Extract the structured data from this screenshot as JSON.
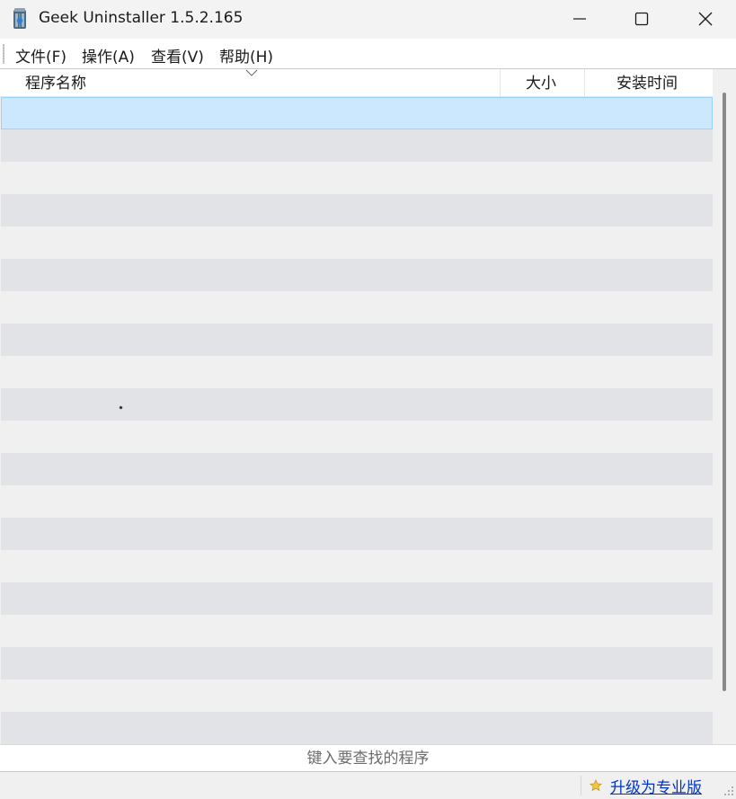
{
  "window": {
    "title": "Geek Uninstaller 1.5.2.165",
    "minimize_icon": "minimize-icon",
    "maximize_icon": "maximize-icon",
    "close_icon": "close-icon"
  },
  "menu": {
    "items": [
      {
        "label": "文件(F)"
      },
      {
        "label": "操作(A)"
      },
      {
        "label": "查看(V)"
      },
      {
        "label": "帮助(H)"
      }
    ]
  },
  "table": {
    "columns": [
      {
        "label": "程序名称"
      },
      {
        "label": "大小"
      },
      {
        "label": "安装时间"
      }
    ],
    "sort_icon": "chevron-down-icon",
    "rows": []
  },
  "search": {
    "placeholder": "键入要查找的程序",
    "value": ""
  },
  "status": {
    "upgrade_label": "升级为专业版",
    "star_icon": "star-icon",
    "link_color": "#0033cc",
    "selection_color": "#cce8ff"
  }
}
